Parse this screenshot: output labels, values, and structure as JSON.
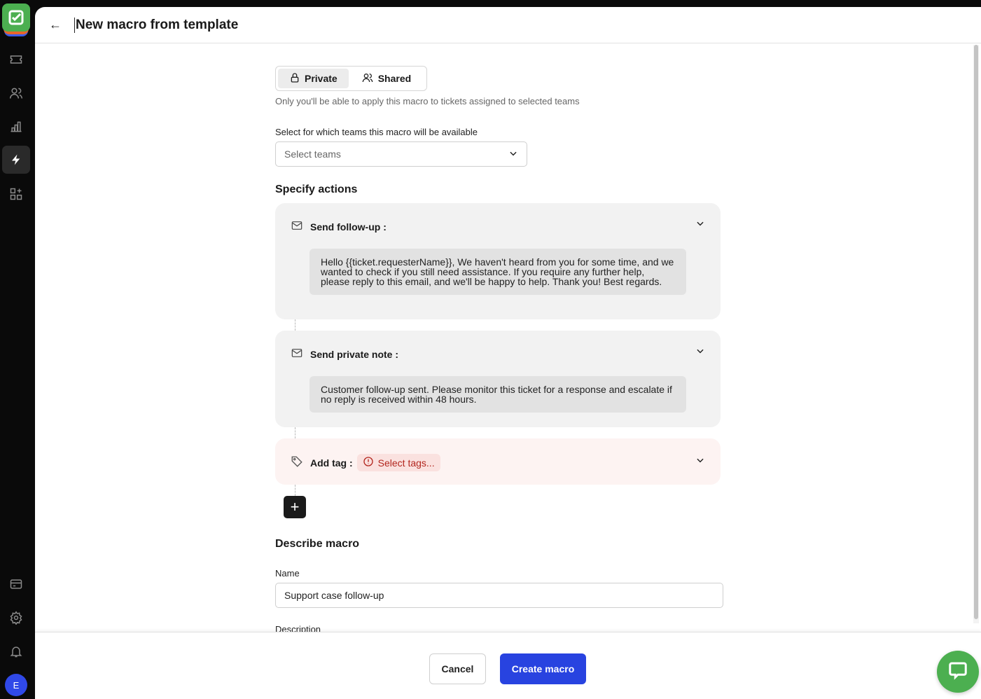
{
  "header": {
    "title": "New macro from template"
  },
  "visibility": {
    "options": [
      "Private",
      "Shared"
    ],
    "selected": "Private",
    "hint": "Only you'll be able to apply this macro to tickets assigned to selected teams"
  },
  "teams": {
    "label": "Select for which teams this macro will be available",
    "placeholder": "Select teams"
  },
  "actions": {
    "heading": "Specify actions",
    "items": [
      {
        "label": "Send follow-up :",
        "icon": "mail-icon",
        "body": "Hello {{ticket.requesterName}}, We haven't heard from you for some time, and we wanted to check if you still need assistance. If you require any further help, please reply to this email, and we'll be happy to help. Thank you! Best regards."
      },
      {
        "label": "Send private note :",
        "icon": "mail-icon",
        "body": "Customer follow-up sent. Please monitor this ticket for a response and escalate if no reply is received within 48 hours."
      },
      {
        "label": "Add tag :",
        "icon": "tag-icon",
        "placeholder": "Select tags..."
      }
    ]
  },
  "describe": {
    "heading": "Describe macro",
    "name_label": "Name",
    "name_value": "Support case follow-up",
    "description_label": "Description"
  },
  "footer": {
    "cancel": "Cancel",
    "create": "Create macro"
  },
  "user": {
    "initial": "E"
  },
  "colors": {
    "accent": "#2843e0",
    "brand": "#4caf50",
    "error": "#b3261e"
  }
}
